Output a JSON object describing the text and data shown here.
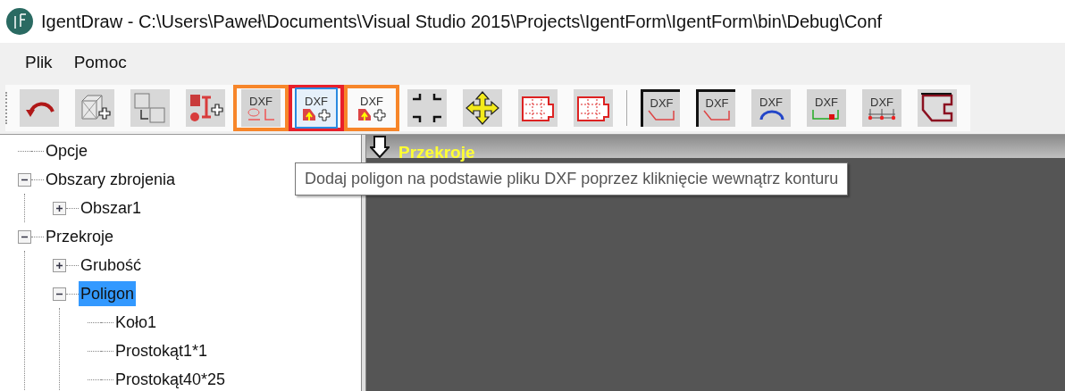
{
  "window": {
    "title": "IgentDraw - C:\\Users\\Paweł\\Documents\\Visual Studio 2015\\Projects\\IgentForm\\IgentForm\\bin\\Debug\\Conf"
  },
  "menu": [
    "Plik",
    "Pomoc"
  ],
  "toolbar": [
    {
      "kind": "arc"
    },
    {
      "kind": "cube-add"
    },
    {
      "kind": "cubes"
    },
    {
      "kind": "shapes-add"
    },
    {
      "kind": "dxf-shapes",
      "label": "DXF",
      "color": "#f7862a"
    },
    {
      "kind": "dxf-add",
      "label": "DXF",
      "color": "#e8202a",
      "selected": true
    },
    {
      "kind": "dxf-add2",
      "label": "DXF",
      "color": "#f7862a"
    },
    {
      "kind": "corners"
    },
    {
      "kind": "move"
    },
    {
      "kind": "dashed"
    },
    {
      "kind": "dashed"
    },
    {
      "kind": "separator"
    },
    {
      "kind": "dxf-framed",
      "label": "DXF"
    },
    {
      "kind": "dxf-framed",
      "label": "DXF"
    },
    {
      "kind": "dxf-arc",
      "label": "DXF"
    },
    {
      "kind": "dxf-green",
      "label": "DXF"
    },
    {
      "kind": "dxf-dots",
      "label": "DXF"
    },
    {
      "kind": "outline"
    }
  ],
  "tree": [
    {
      "label": "Opcje",
      "selected": false
    },
    {
      "label": "Obszary zbrojenia",
      "expanded": true,
      "selected": false,
      "children": [
        {
          "label": "Obszar1",
          "expanded": false,
          "selected": false
        }
      ]
    },
    {
      "label": "Przekroje",
      "expanded": true,
      "selected": false,
      "children": [
        {
          "label": "Grubość",
          "expanded": false,
          "selected": false
        },
        {
          "label": "Poligon",
          "expanded": true,
          "selected": true,
          "children": [
            {
              "label": "Koło1",
              "selected": false
            },
            {
              "label": "Prostokąt1*1",
              "selected": false
            },
            {
              "label": "Prostokąt40*25",
              "selected": false
            }
          ]
        }
      ]
    }
  ],
  "canvas": {
    "header": "Przekroje"
  },
  "tooltip": "Dodaj poligon na podstawie pliku DXF poprzez kliknięcie wewnątrz konturu"
}
